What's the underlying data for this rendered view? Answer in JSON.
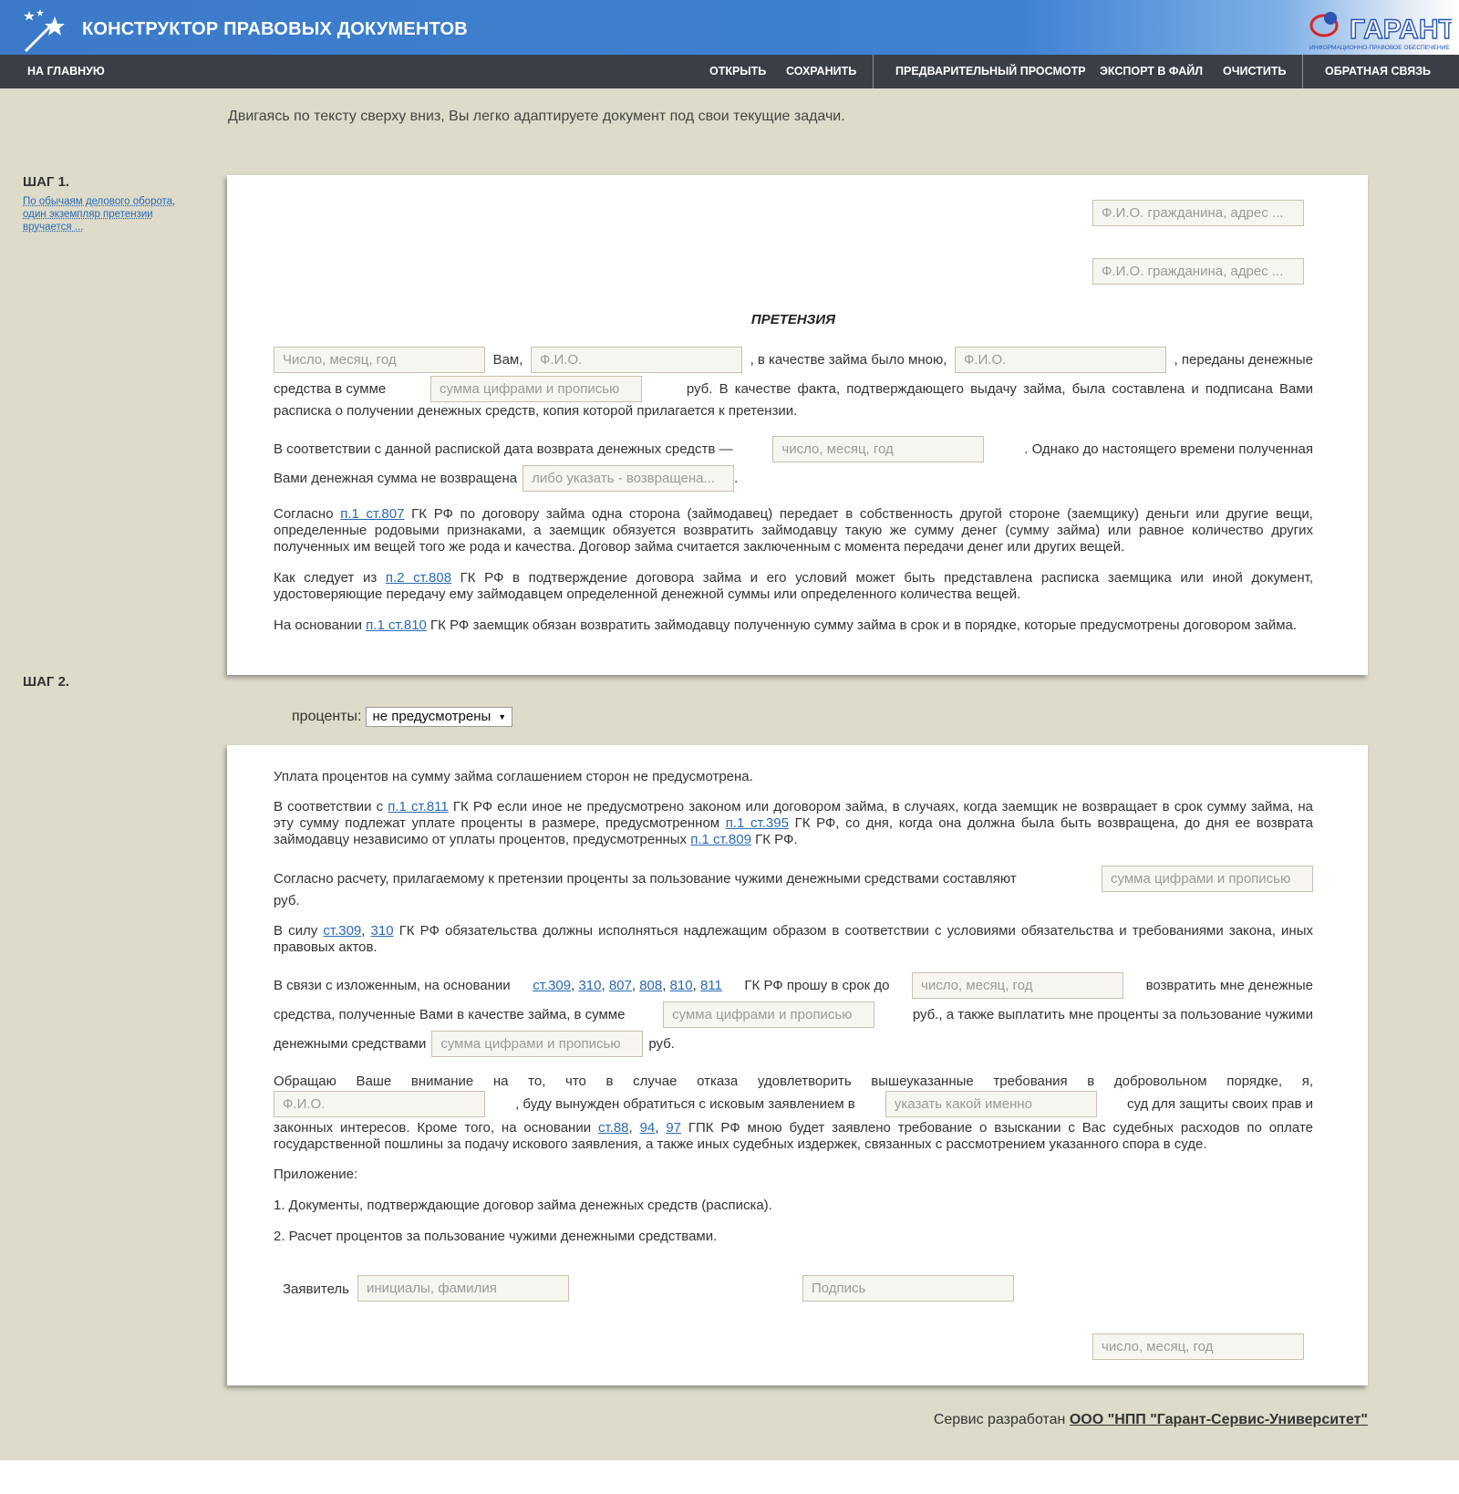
{
  "header": {
    "title": "КОНСТРУКТОР ПРАВОВЫХ ДОКУМЕНТОВ",
    "logo_text": "ГАРАНТ",
    "logo_subtitle": "ИНФОРМАЦИОННО-ПРАВОВОЕ ОБЕСПЕЧЕНИЕ"
  },
  "nav": {
    "home": "НА ГЛАВНУЮ",
    "open": "ОТКРЫТЬ",
    "save": "СОХРАНИТЬ",
    "preview": "ПРЕДВАРИТЕЛЬНЫЙ ПРОСМОТР",
    "export": "ЭКСПОРТ В ФАЙЛ",
    "clear": "ОЧИСТИТЬ",
    "feedback": "ОБРАТНАЯ СВЯЗЬ"
  },
  "intro": "Двигаясь по тексту сверху вниз, Вы легко адаптируете документ под свои текущие задачи.",
  "step1": {
    "label": "ШАГ 1.",
    "hint": "По обычаям делового оборота, один экземпляр претензии вручается ..."
  },
  "step2": {
    "label": "ШАГ 2.",
    "interest_label": "проценты:",
    "interest_value": "не предусмотрены"
  },
  "doc1": {
    "recipient_placeholder": "Ф.И.О. гражданина, адрес ...",
    "sender_placeholder": "Ф.И.О. гражданина, адрес ...",
    "title": "ПРЕТЕНЗИЯ",
    "date_placeholder": "Число, месяц, год",
    "t_vam": "Вам,",
    "fio1_placeholder": "Ф.И.О.",
    "t_loan": ", в качестве займа было мною,",
    "fio2_placeholder": "Ф.И.О.",
    "t_transferred": ", переданы денежные",
    "t_funds_sum": "средства в сумме",
    "sum_placeholder": "сумма цифрами и прописью",
    "t_rub_fact": "руб. В качестве факта, подтверждающего выдачу займа, была составлена и подписана Вами",
    "t_receipt": "расписка о получении денежных средств, копия которой прилагается к претензии.",
    "t_accordance": "В соответствии с данной распиской дата возврата денежных средств —",
    "return_date_placeholder": "число, месяц, год",
    "t_however": ". Однако до настоящего времени полученная",
    "t_not_returned": "Вами денежная сумма не возвращена",
    "returned_placeholder": "либо указать - возвращена...",
    "t_dot": ".",
    "p807_a": "Согласно ",
    "p807_link": "п.1 ст.807",
    "p807_b": " ГК РФ по договору займа одна сторона (займодавец) передает в собственность другой стороне (заемщику) деньги или другие вещи, определенные родовыми признаками, а заемщик обязуется возвратить займодавцу такую же сумму денег (сумму займа) или равное количество других полученных им вещей того же рода и качества. Договор займа считается заключенным с момента передачи денег или других вещей.",
    "p808_a": "Как следует из ",
    "p808_link": "п.2 ст.808",
    "p808_b": " ГК РФ в подтверждение договора займа и его условий может быть представлена расписка заемщика или иной документ, удостоверяющие передачу ему займодавцем определенной денежной суммы или определенного количества вещей.",
    "p810_a": "На основании ",
    "p810_link": "п.1 ст.810",
    "p810_b": " ГК РФ заемщик обязан возвратить займодавцу полученную сумму займа в срок и в порядке, которые предусмотрены договором займа."
  },
  "doc2": {
    "p_no_interest": "Уплата процентов на сумму займа соглашением сторон не предусмотрена.",
    "p811_a": "В соответствии с ",
    "p811_link": "п.1 ст.811",
    "p811_b": " ГК РФ если иное не предусмотрено законом или договором займа, в случаях, когда заемщик не возвращает в срок сумму займа, на эту сумму подлежат уплате проценты в размере, предусмотренном ",
    "p395_link": "п.1 ст.395",
    "p811_c": " ГК РФ, со дня, когда она должна была быть возвращена, до дня ее возврата займодавцу независимо от уплаты процентов, предусмотренных ",
    "p809_link": "п.1 ст.809",
    "p811_d": " ГК РФ.",
    "t_calc": "Согласно расчету, прилагаемому к претензии проценты за пользование чужими денежными средствами составляют",
    "interest_sum_placeholder": "сумма цифрами и прописью",
    "t_rub": "руб.",
    "p309_a": "В силу ",
    "p309_link": "ст.309",
    "p310_link": "310",
    "p309_b": " ГК РФ обязательства должны исполняться надлежащим образом в соответствии с условиями обязательства и требованиями закона, иных правовых актов.",
    "demand_a": "В связи с изложенным, на основании",
    "demand_links": [
      "ст.309",
      "310",
      "807",
      "808",
      "810",
      "811"
    ],
    "demand_b": "ГК РФ прошу в срок до",
    "deadline_placeholder": "число, месяц, год",
    "demand_c": "возвратить мне денежные",
    "demand_d": "средства, полученные Вами в качестве займа, в сумме",
    "loan_sum_placeholder": "сумма цифрами и прописью",
    "demand_e": "руб., а также выплатить мне проценты за пользование чужими",
    "demand_f": "денежными средствами",
    "interest2_placeholder": "сумма цифрами и прописью",
    "demand_g": "руб.",
    "court_a": "Обращаю Ваше внимание на то, что в случае отказа удовлетворить вышеуказанные требования в добровольном порядке, я,",
    "court_fio_placeholder": "Ф.И.О.",
    "court_b": ", буду вынужден обратиться с исковым заявлением в",
    "court_name_placeholder": "указать какой именно",
    "court_c": "суд для защиты своих прав и",
    "court_d": "законных интересов. Кроме того, на основании ",
    "court_links": [
      "ст.88",
      "94",
      "97"
    ],
    "court_e": " ГПК РФ мною будет заявлено требование о взыскании с Вас судебных расходов по оплате государственной пошлины за подачу искового заявления, а также иных судебных издержек, связанных с рассмотрением указанного спора в суде.",
    "appendix_title": "Приложение:",
    "appendix_1": "1. Документы, подтверждающие договор займа денежных средств (расписка).",
    "appendix_2": "2. Расчет процентов за пользование чужими денежными средствами.",
    "applicant_label": "Заявитель",
    "initials_placeholder": "инициалы, фамилия",
    "signature_placeholder": "Подпись",
    "sign_date_placeholder": "число, месяц, год"
  },
  "footer": {
    "text": "Сервис разработан ",
    "link": "ООО \"НПП \"Гарант-Сервис-Университет\""
  }
}
